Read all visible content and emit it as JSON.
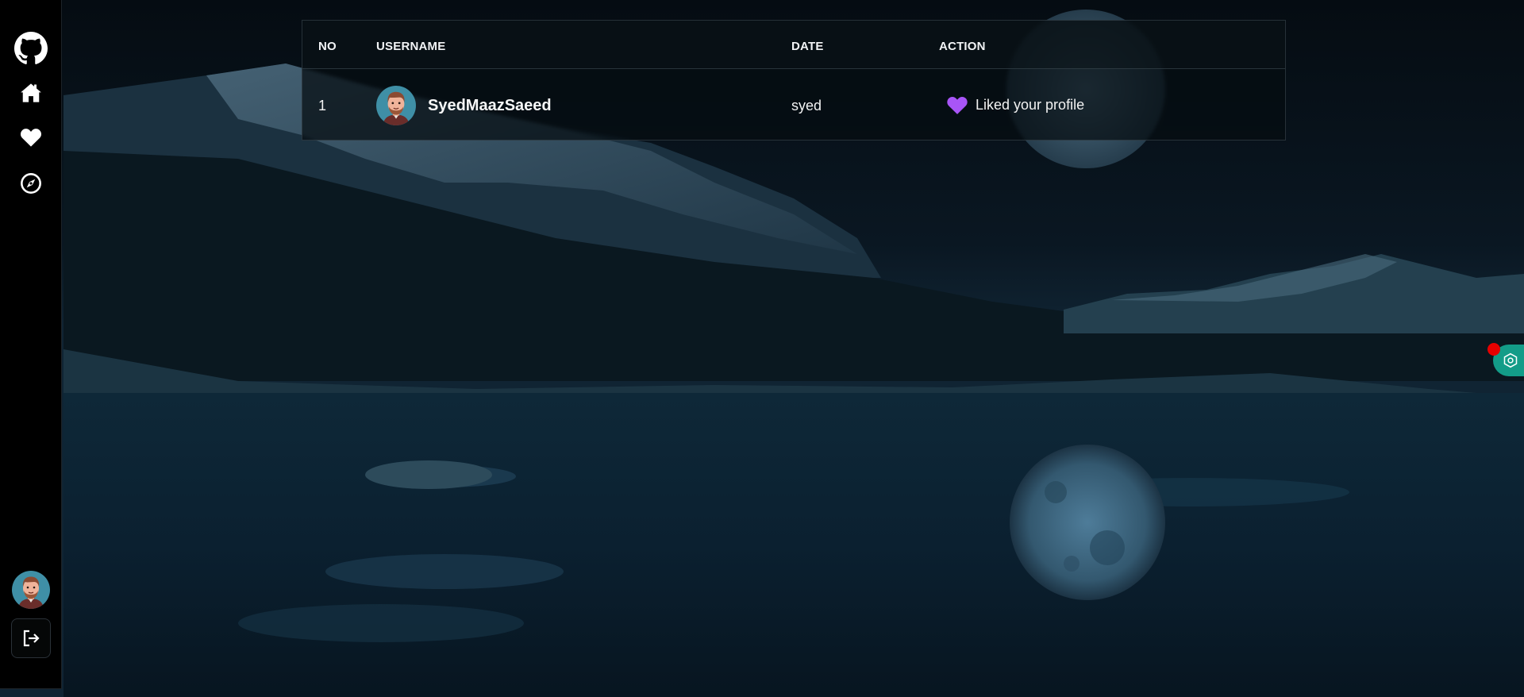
{
  "colors": {
    "accent_heart": "#a855f7",
    "widget_green": "#139c88",
    "widget_dot": "#e60000"
  },
  "sidebar": {
    "items": [
      {
        "name": "github",
        "icon": "github-icon"
      },
      {
        "name": "home",
        "icon": "home-icon"
      },
      {
        "name": "likes",
        "icon": "heart-icon"
      },
      {
        "name": "explore",
        "icon": "compass-icon"
      }
    ],
    "avatar_icon": "avatar",
    "logout_icon": "logout-icon"
  },
  "table": {
    "headers": {
      "no": "NO",
      "username": "USERNAME",
      "date": "DATE",
      "action": "ACTION"
    },
    "rows": [
      {
        "no": "1",
        "username": "SyedMaazSaeed",
        "date": "syed",
        "action_icon": "heart-icon",
        "action": "Liked your profile"
      }
    ]
  },
  "floating_widget": {
    "icon": "hexagon-settings-icon"
  }
}
